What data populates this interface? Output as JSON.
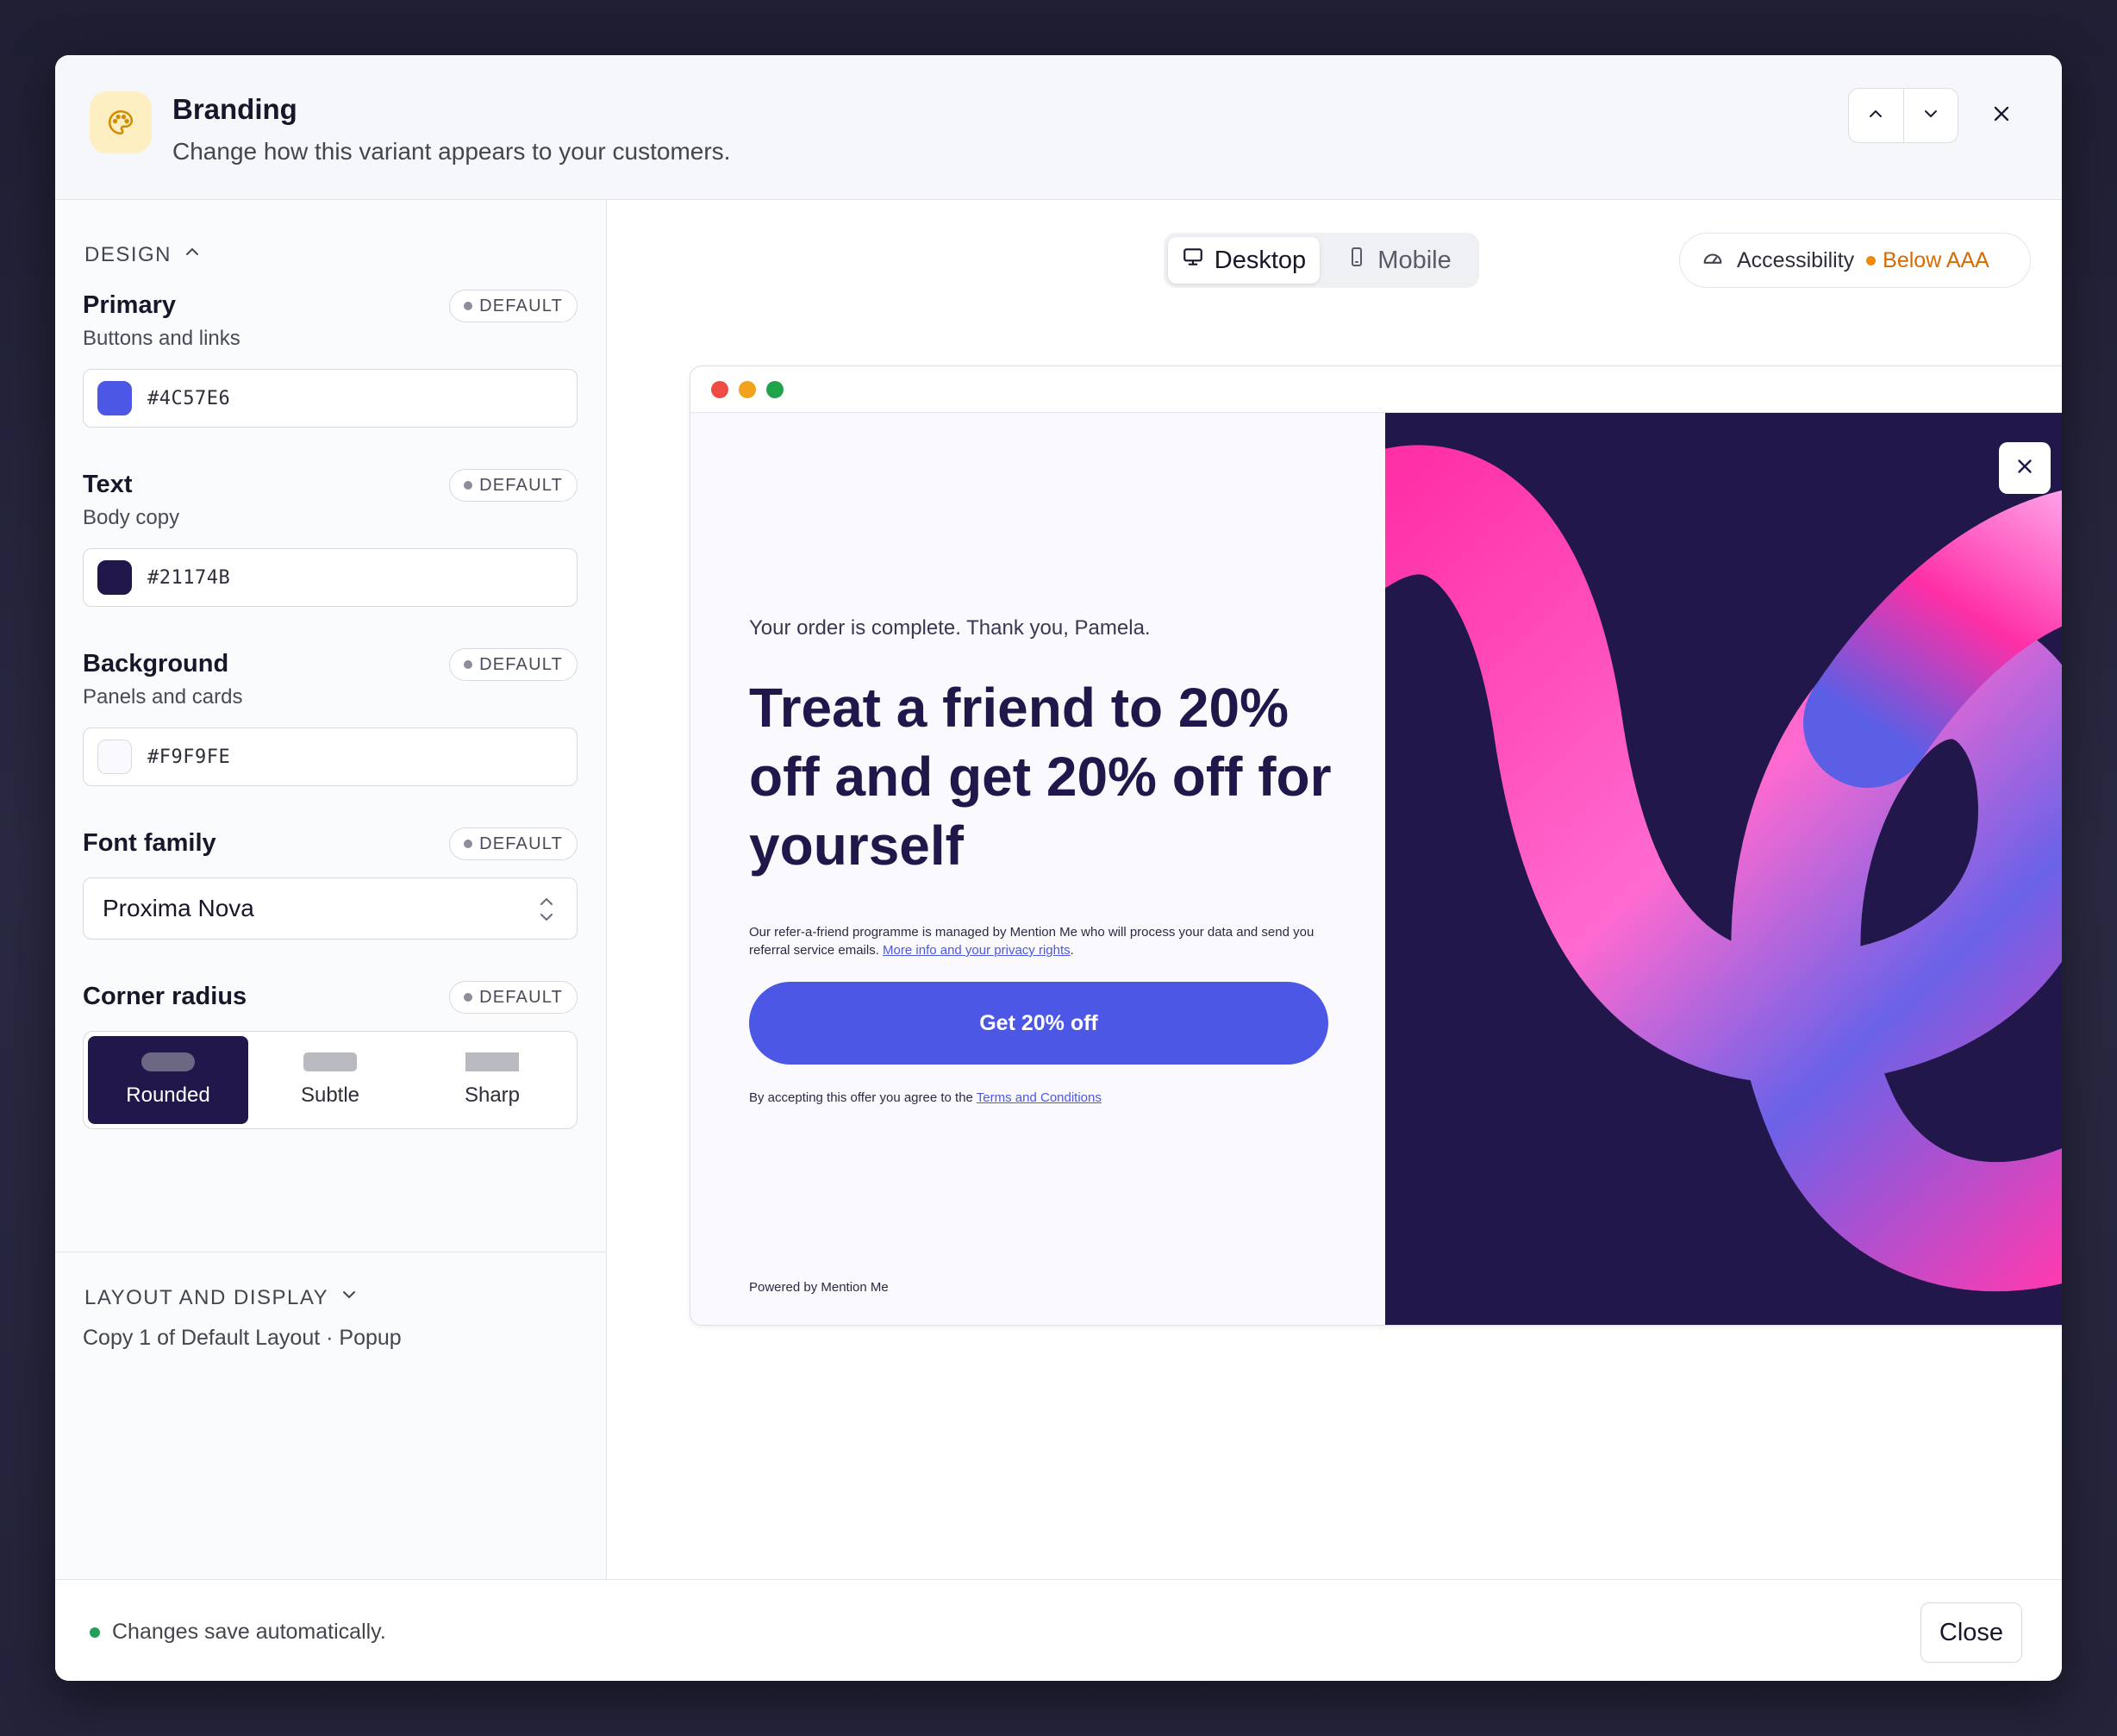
{
  "header": {
    "title": "Branding",
    "subtitle": "Change how this variant appears to your customers.",
    "icon": "palette-icon"
  },
  "design": {
    "section_label": "DESIGN",
    "default_badge": "DEFAULT",
    "primary": {
      "label": "Primary",
      "sub": "Buttons and links",
      "value": "#4C57E6",
      "color": "#4C57E6"
    },
    "text": {
      "label": "Text",
      "sub": "Body copy",
      "value": "#21174B",
      "color": "#21174B"
    },
    "background": {
      "label": "Background",
      "sub": "Panels and cards",
      "value": "#F9F9FE",
      "color": "#F9F9FE"
    },
    "font": {
      "label": "Font family",
      "value": "Proxima Nova"
    },
    "radius": {
      "label": "Corner radius",
      "options": [
        "Rounded",
        "Subtle",
        "Sharp"
      ],
      "selected": "Rounded"
    }
  },
  "layout": {
    "section_label": "LAYOUT AND DISPLAY",
    "summary": "Copy 1 of Default Layout · Popup"
  },
  "preview": {
    "tabs": [
      "Desktop",
      "Mobile"
    ],
    "active_tab": "Desktop",
    "accessibility_label": "Accessibility",
    "accessibility_status": "Below AAA",
    "popup": {
      "intro": "Your order is complete. Thank you, Pamela.",
      "headline": "Treat a friend to 20% off and get 20% off for yourself",
      "fine_print": "Our refer-a-friend programme is managed by Mention Me who will process your data and send you referral service emails.",
      "fine_link": "More info and your privacy rights",
      "cta": "Get 20% off",
      "terms_prefix": "By accepting this offer you agree to the",
      "terms_link": "Terms and Conditions",
      "powered": "Powered by Mention Me"
    }
  },
  "footer": {
    "status": "Changes save automatically.",
    "close_label": "Close"
  }
}
